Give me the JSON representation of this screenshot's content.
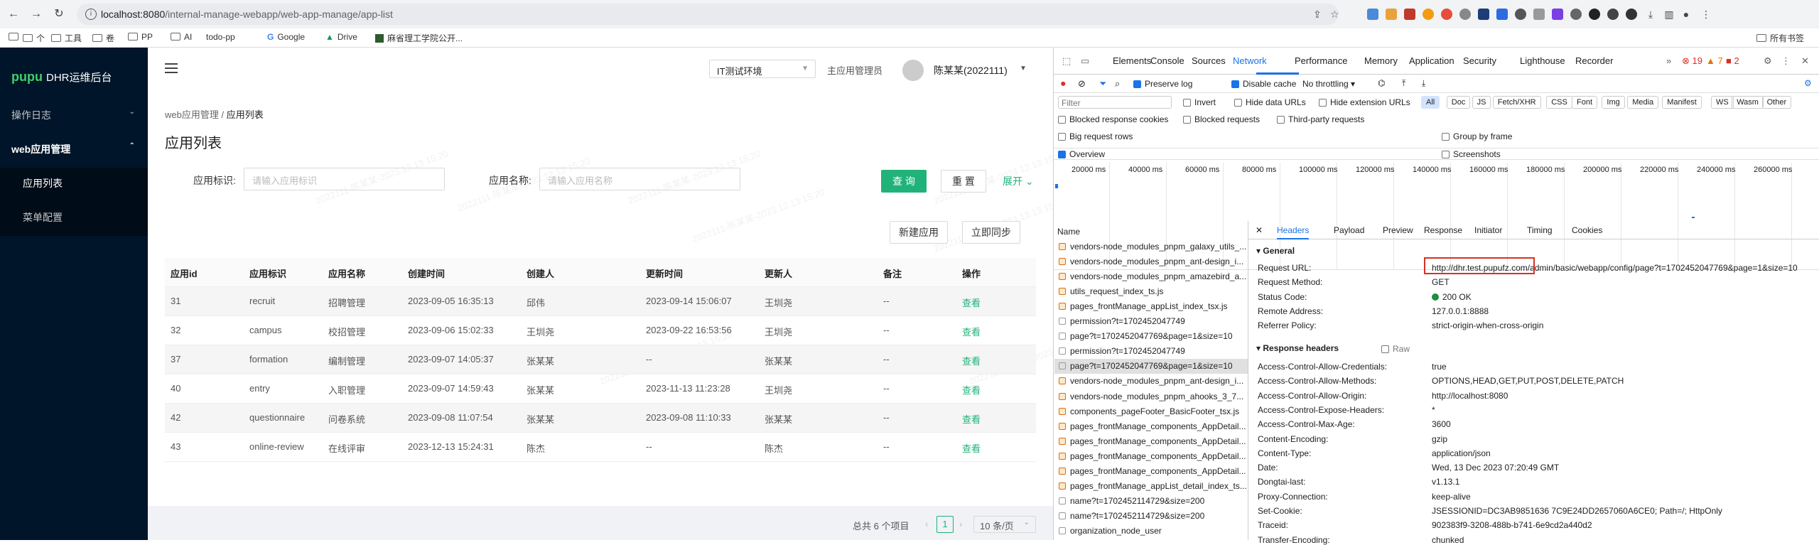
{
  "browser": {
    "url_host": "localhost:8080",
    "url_path": "/internal-manage-webapp/web-app-manage/app-list",
    "bookmarks": [
      "个",
      "工具",
      "卷",
      "PP",
      "AI",
      "todo-pp",
      "Google",
      "Drive",
      "麻省理工学院公开..."
    ],
    "all_bookmarks": "所有书签",
    "dt_errors": "19",
    "dt_warnings": "7",
    "dt_issues": "2"
  },
  "app": {
    "logo": "pupu",
    "name": "DHR运维后台",
    "menu": {
      "log": "操作日志",
      "webapp": "web应用管理",
      "app_list": "应用列表",
      "menu_config": "菜单配置"
    },
    "header": {
      "env": "IT测试环境",
      "role": "主应用管理员",
      "user": "陈某某(2022111)"
    },
    "breadcrumb": {
      "parent": "web应用管理",
      "sep": "/",
      "current": "应用列表"
    },
    "title": "应用列表",
    "search": {
      "id_label": "应用标识:",
      "id_placeholder": "请输入应用标识",
      "name_label": "应用名称:",
      "name_placeholder": "请输入应用名称",
      "query": "查 询",
      "reset": "重 置",
      "expand": "展开"
    },
    "actions": {
      "new_app": "新建应用",
      "sync": "立即同步"
    },
    "watermark": "2022111-陈某某-2023.12.13 15:20",
    "table": {
      "columns": [
        "应用id",
        "应用标识",
        "应用名称",
        "创建时间",
        "创建人",
        "更新时间",
        "更新人",
        "备注",
        "操作"
      ],
      "rows": [
        [
          "31",
          "recruit",
          "招聘管理",
          "2023-09-05 16:35:13",
          "邱伟",
          "2023-09-14 15:06:07",
          "王圳尧",
          "--",
          "查看"
        ],
        [
          "32",
          "campus",
          "校招管理",
          "2023-09-06 15:02:33",
          "王圳尧",
          "2023-09-22 16:53:56",
          "王圳尧",
          "--",
          "查看"
        ],
        [
          "37",
          "formation",
          "编制管理",
          "2023-09-07 14:05:37",
          "张某某",
          "--",
          "张某某",
          "--",
          "查看"
        ],
        [
          "40",
          "entry",
          "入职管理",
          "2023-09-07 14:59:43",
          "张某某",
          "2023-11-13 11:23:28",
          "王圳尧",
          "--",
          "查看"
        ],
        [
          "42",
          "questionnaire",
          "问卷系统",
          "2023-09-08 11:07:54",
          "张某某",
          "2023-09-08 11:10:33",
          "张某某",
          "--",
          "查看"
        ],
        [
          "43",
          "online-review",
          "在线评审",
          "2023-12-13 15:24:31",
          "陈杰",
          "--",
          "陈杰",
          "--",
          "查看"
        ]
      ]
    },
    "pagination": {
      "total": "总共 6 个项目",
      "page": "1",
      "size": "10 条/页"
    }
  },
  "devtools": {
    "tabs": [
      "Elements",
      "Console",
      "Sources",
      "Network",
      "Performance",
      "Memory",
      "Application",
      "Security",
      "Lighthouse",
      "Recorder"
    ],
    "active_tab": "Network",
    "toolbar": {
      "preserve_log": "Preserve log",
      "disable_cache": "Disable cache",
      "throttling": "No throttling"
    },
    "filter": {
      "placeholder": "Filter",
      "invert": "Invert",
      "hide_data": "Hide data URLs",
      "hide_ext": "Hide extension URLs",
      "types": [
        "All",
        "Doc",
        "JS",
        "Fetch/XHR",
        "CSS",
        "Font",
        "Img",
        "Media",
        "Manifest",
        "WS",
        "Wasm",
        "Other"
      ]
    },
    "blocked_cookies": "Blocked response cookies",
    "blocked_requests": "Blocked requests",
    "third_party": "Third-party requests",
    "big_rows": "Big request rows",
    "group_frame": "Group by frame",
    "overview": "Overview",
    "screenshots": "Screenshots",
    "overview_ticks": [
      "20000 ms",
      "40000 ms",
      "60000 ms",
      "80000 ms",
      "100000 ms",
      "120000 ms",
      "140000 ms",
      "160000 ms",
      "180000 ms",
      "200000 ms",
      "220000 ms",
      "240000 ms",
      "260000 ms"
    ],
    "name_header": "Name",
    "requests": [
      "vendors-node_modules_pnpm_galaxy_utils_...",
      "vendors-node_modules_pnpm_ant-design_i...",
      "vendors-node_modules_pnpm_amazebird_a...",
      "utils_request_index_ts.js",
      "pages_frontManage_appList_index_tsx.js",
      "permission?t=1702452047749",
      "page?t=1702452047769&page=1&size=10",
      "permission?t=1702452047749",
      "page?t=1702452047769&page=1&size=10",
      "vendors-node_modules_pnpm_ant-design_i...",
      "vendors-node_modules_pnpm_ahooks_3_7...",
      "components_pageFooter_BasicFooter_tsx.js",
      "pages_frontManage_components_AppDetail...",
      "pages_frontManage_components_AppDetail...",
      "pages_frontManage_components_AppDetail...",
      "pages_frontManage_components_AppDetail...",
      "pages_frontManage_appList_detail_index_ts...",
      "name?t=1702452114729&size=200",
      "name?t=1702452114729&size=200",
      "organization_node_user"
    ],
    "detail_tabs": [
      "Headers",
      "Payload",
      "Preview",
      "Response",
      "Initiator",
      "Timing",
      "Cookies"
    ],
    "general_title": "General",
    "general": [
      [
        "Request URL:",
        "http://dhr.test.pupufz.com/admin/basic/webapp/config/page?t=1702452047769&page=1&size=10"
      ],
      [
        "Request Method:",
        "GET"
      ],
      [
        "Status Code:",
        "200 OK"
      ],
      [
        "Remote Address:",
        "127.0.0.1:8888"
      ],
      [
        "Referrer Policy:",
        "strict-origin-when-cross-origin"
      ]
    ],
    "response_title": "Response headers",
    "raw": "Raw",
    "response": [
      [
        "Access-Control-Allow-Credentials:",
        "true"
      ],
      [
        "Access-Control-Allow-Methods:",
        "OPTIONS,HEAD,GET,PUT,POST,DELETE,PATCH"
      ],
      [
        "Access-Control-Allow-Origin:",
        "http://localhost:8080"
      ],
      [
        "Access-Control-Expose-Headers:",
        "*"
      ],
      [
        "Access-Control-Max-Age:",
        "3600"
      ],
      [
        "Content-Encoding:",
        "gzip"
      ],
      [
        "Content-Type:",
        "application/json"
      ],
      [
        "Date:",
        "Wed, 13 Dec 2023 07:20:49 GMT"
      ],
      [
        "Dongtai-last:",
        "v1.13.1"
      ],
      [
        "Proxy-Connection:",
        "keep-alive"
      ],
      [
        "Set-Cookie:",
        "JSESSIONID=DC3AB9851636 7C9E24DD2657060A6CE0; Path=/; HttpOnly"
      ],
      [
        "Traceid:",
        "902383f9-3208-488b-b741-6e9cd2a440d2"
      ],
      [
        "Transfer-Encoding:",
        "chunked"
      ]
    ],
    "status_color": "#1e8e3e",
    "highlight_color": "#d93025"
  }
}
